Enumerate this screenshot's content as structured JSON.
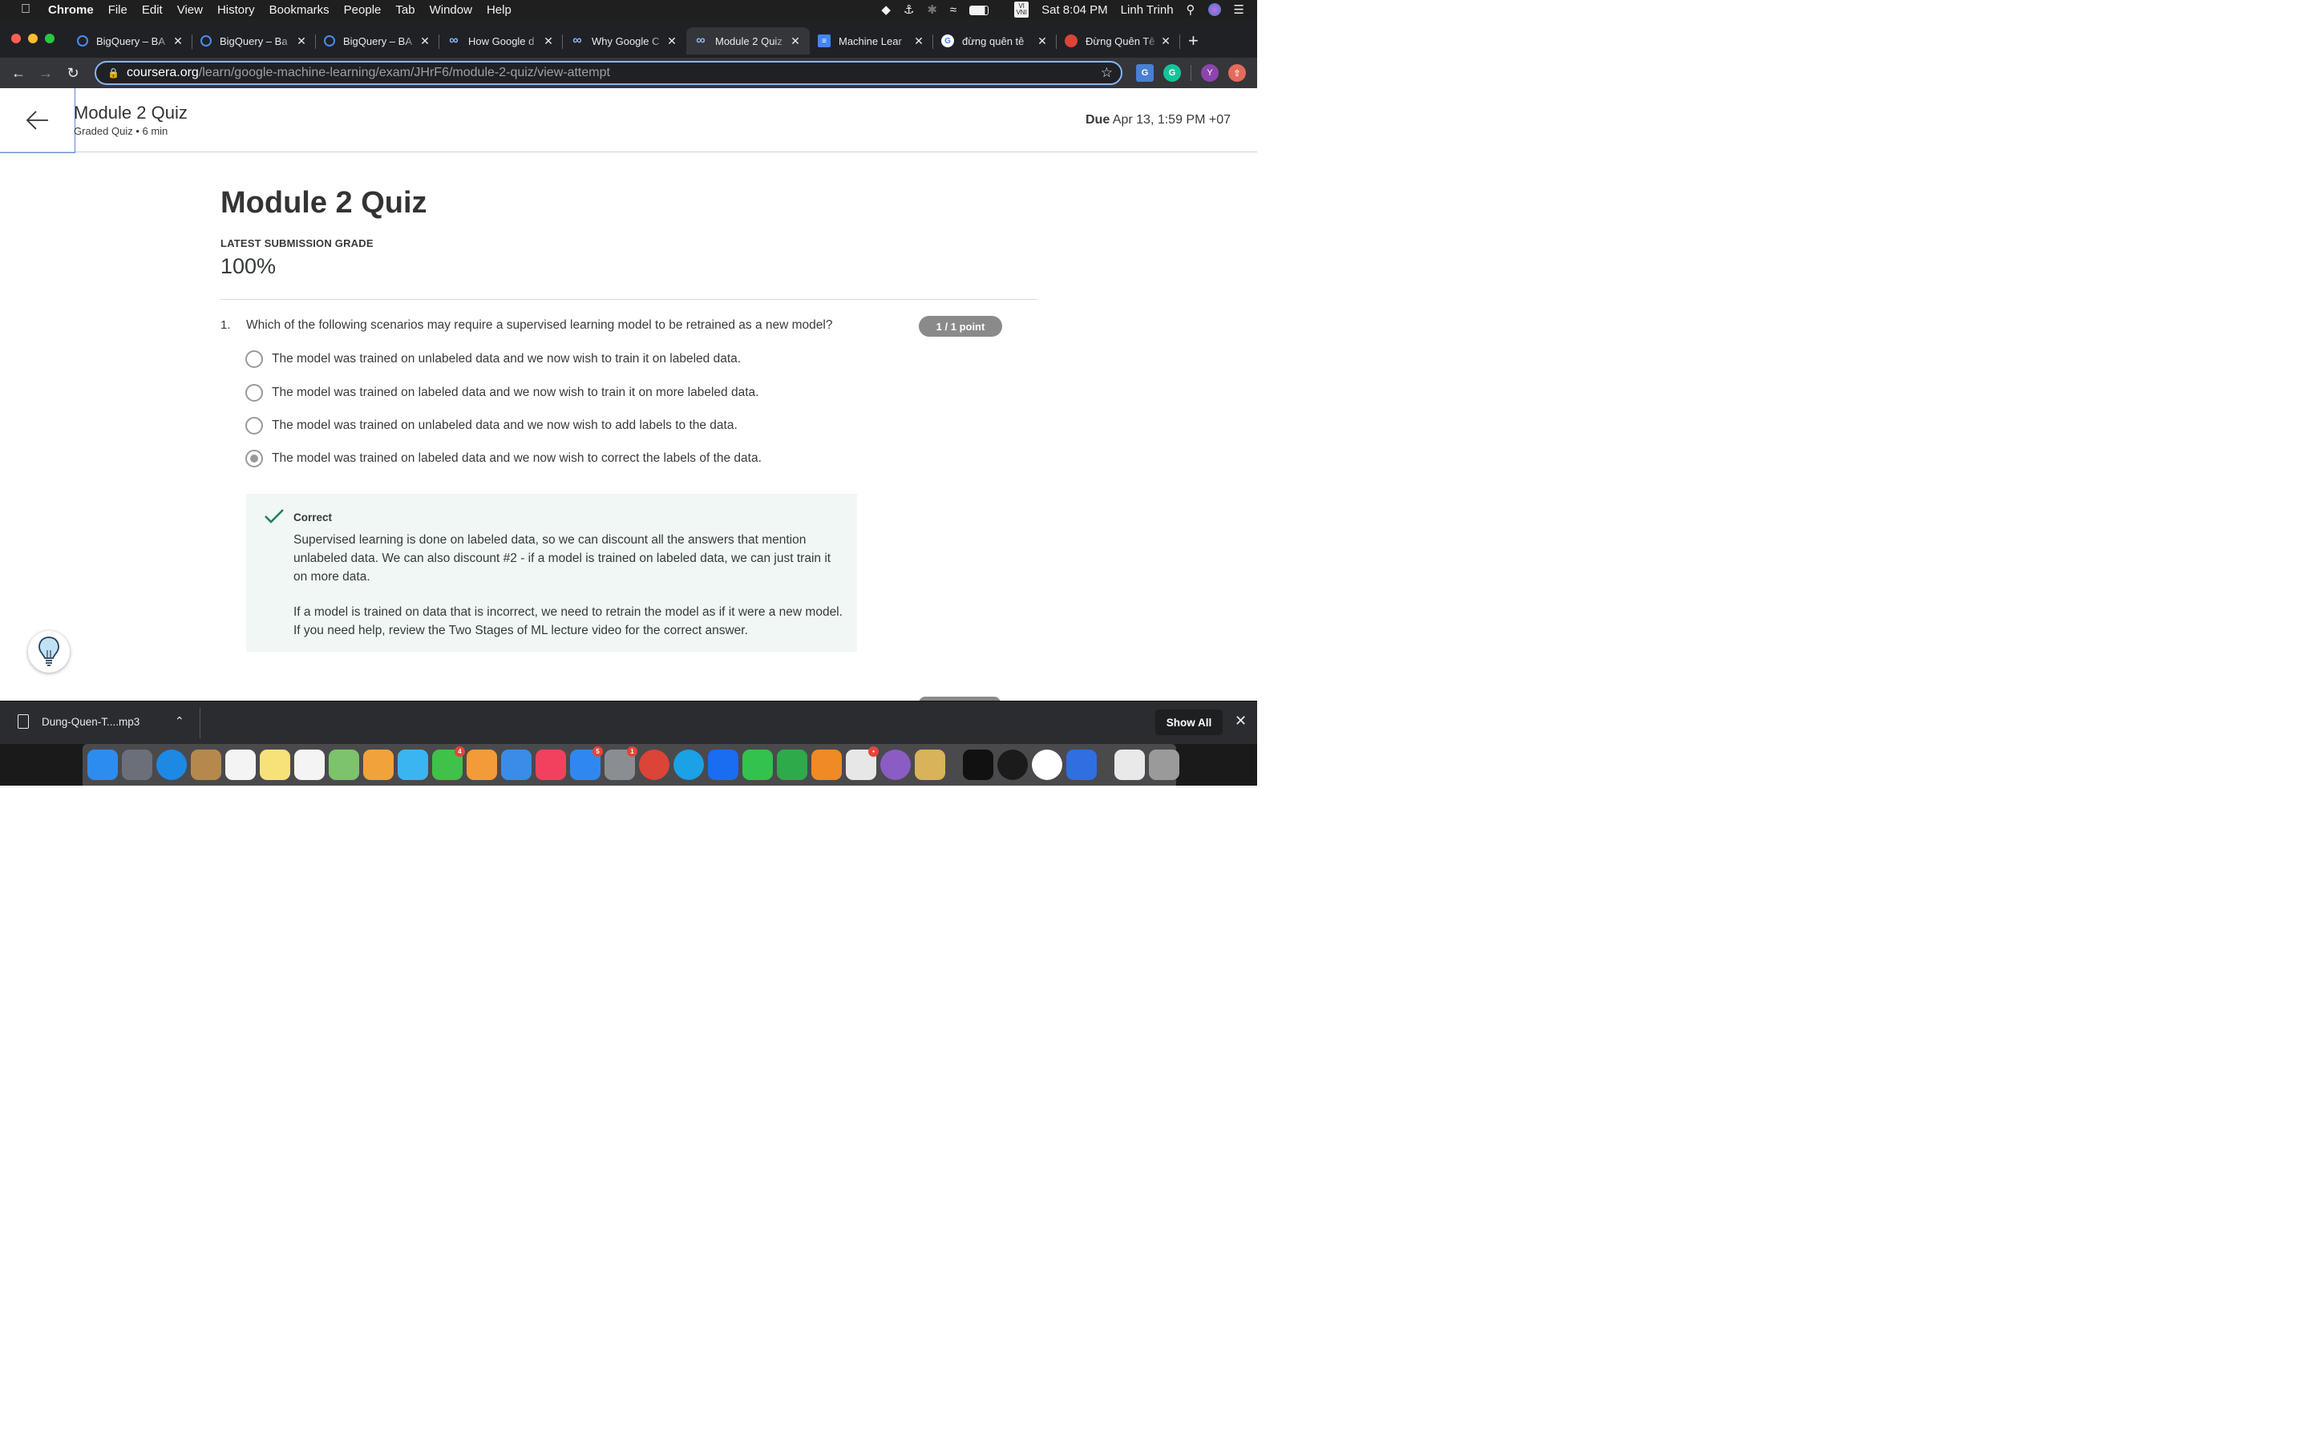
{
  "menubar": {
    "app": "Chrome",
    "items": [
      "File",
      "Edit",
      "View",
      "History",
      "Bookmarks",
      "People",
      "Tab",
      "Window",
      "Help"
    ],
    "input_source": "VI VNI",
    "clock": "Sat 8:04 PM",
    "user": "Linh Trinh"
  },
  "tabs": [
    {
      "label": "BigQuery – BA",
      "icon": "bigquery-icon",
      "color": "#4c8bf5",
      "active": false
    },
    {
      "label": "BigQuery – Ba",
      "icon": "bigquery-icon",
      "color": "#4c8bf5",
      "active": false
    },
    {
      "label": "BigQuery – BA",
      "icon": "bigquery-icon",
      "color": "#4c8bf5",
      "active": false
    },
    {
      "label": "How Google d",
      "icon": "coursera-icon",
      "color": "#8ab4f8",
      "active": false
    },
    {
      "label": "Why Google C",
      "icon": "coursera-icon",
      "color": "#8ab4f8",
      "active": false
    },
    {
      "label": "Module 2 Quiz",
      "icon": "coursera-icon",
      "color": "#8ab4f8",
      "active": true
    },
    {
      "label": "Machine Lear",
      "icon": "google-docs-icon",
      "color": "#4285f4",
      "active": false
    },
    {
      "label": "đừng quên tê",
      "icon": "google-icon",
      "color": "#ffffff",
      "active": false
    },
    {
      "label": "Đừng Quên Tê",
      "icon": "chrome-icon",
      "color": "#db4437",
      "active": false
    }
  ],
  "address": {
    "host": "coursera.org",
    "path": "/learn/google-machine-learning/exam/JHrF6/module-2-quiz/view-attempt"
  },
  "profile_initial": "Y",
  "header": {
    "title": "Module 2 Quiz",
    "subtitle": "Graded Quiz • 6 min",
    "due_label": "Due",
    "due_value": "Apr 13, 1:59 PM +07"
  },
  "quiz": {
    "title": "Module 2 Quiz",
    "grade_label": "LATEST SUBMISSION GRADE",
    "grade_value": "100%",
    "question": {
      "number": "1.",
      "text": "Which of the following scenarios may require a supervised learning model to be retrained as a new model?",
      "points": "1 / 1 point",
      "options": [
        {
          "text": "The model was trained on unlabeled data and we now wish to train it on labeled data.",
          "selected": false
        },
        {
          "text": "The model was trained on labeled data and we now wish to train it on more labeled data.",
          "selected": false
        },
        {
          "text": "The model was trained on unlabeled data and we now wish to add labels to the data.",
          "selected": false
        },
        {
          "text": "The model was trained on labeled data and we now wish to correct the labels of the data.",
          "selected": true
        }
      ],
      "feedback": {
        "label": "Correct",
        "para1": "Supervised learning is done on labeled data, so we can discount all the answers that mention unlabeled data. We can also discount #2 - if a model is trained on labeled data, we can just train it on more data.",
        "para2": "If a model is trained on data that is incorrect, we need to retrain the model as if it were a new model. If you need help, review the Two Stages of ML lecture video for the correct answer."
      }
    }
  },
  "download": {
    "filename": "Dung-Quen-T....mp3",
    "show_all": "Show All"
  },
  "dock": [
    {
      "name": "finder-icon",
      "color": "#2d8cf0",
      "badge": ""
    },
    {
      "name": "launchpad-icon",
      "color": "#6b6f7a",
      "badge": ""
    },
    {
      "name": "safari-icon",
      "color": "#1e88e5",
      "badge": ""
    },
    {
      "name": "contacts-icon",
      "color": "#b5894e",
      "badge": ""
    },
    {
      "name": "calendar-icon",
      "color": "#f4f4f4",
      "badge": ""
    },
    {
      "name": "notes-icon",
      "color": "#f7e27a",
      "badge": ""
    },
    {
      "name": "reminders-icon",
      "color": "#f4f4f4",
      "badge": ""
    },
    {
      "name": "maps-icon",
      "color": "#7cc36c",
      "badge": ""
    },
    {
      "name": "photos-icon",
      "color": "#f2a23a",
      "badge": ""
    },
    {
      "name": "messages-icon",
      "color": "#3bb4f2",
      "badge": ""
    },
    {
      "name": "facetime-icon",
      "color": "#3fc14a",
      "badge": "4"
    },
    {
      "name": "pages-icon",
      "color": "#f29b38",
      "badge": ""
    },
    {
      "name": "keynote-icon",
      "color": "#3a8ce8",
      "badge": ""
    },
    {
      "name": "music-icon",
      "color": "#f2415e",
      "badge": ""
    },
    {
      "name": "app-store-icon",
      "color": "#2f88f0",
      "badge": "5"
    },
    {
      "name": "system-preferences-icon",
      "color": "#8a8d92",
      "badge": "1"
    },
    {
      "name": "chrome-icon",
      "color": "#db4437",
      "badge": ""
    },
    {
      "name": "skype-icon",
      "color": "#1aa1e6",
      "badge": ""
    },
    {
      "name": "zalo-icon",
      "color": "#1a6cf0",
      "badge": ""
    },
    {
      "name": "line-icon",
      "color": "#33c24d",
      "badge": ""
    },
    {
      "name": "navicat-icon",
      "color": "#2eaa4a",
      "badge": ""
    },
    {
      "name": "sublime-text-icon",
      "color": "#f08a24",
      "badge": ""
    },
    {
      "name": "slack-icon",
      "color": "#e7e7e7",
      "badge": "•"
    },
    {
      "name": "github-desktop-icon",
      "color": "#8b5cc4",
      "badge": ""
    },
    {
      "name": "archive-utility-icon",
      "color": "#d8b35a",
      "badge": ""
    },
    {
      "name": "terminal-icon",
      "color": "#111111",
      "badge": ""
    },
    {
      "name": "activity-monitor-icon",
      "color": "#1b1b1b",
      "badge": ""
    },
    {
      "name": "mongodb-compass-icon",
      "color": "#ffffff",
      "badge": ""
    },
    {
      "name": "jira-icon",
      "color": "#2f6fe0",
      "badge": ""
    },
    {
      "name": "python-file-icon",
      "color": "#e9e9e9",
      "badge": ""
    },
    {
      "name": "trash-icon",
      "color": "#9a9a9a",
      "badge": ""
    }
  ]
}
